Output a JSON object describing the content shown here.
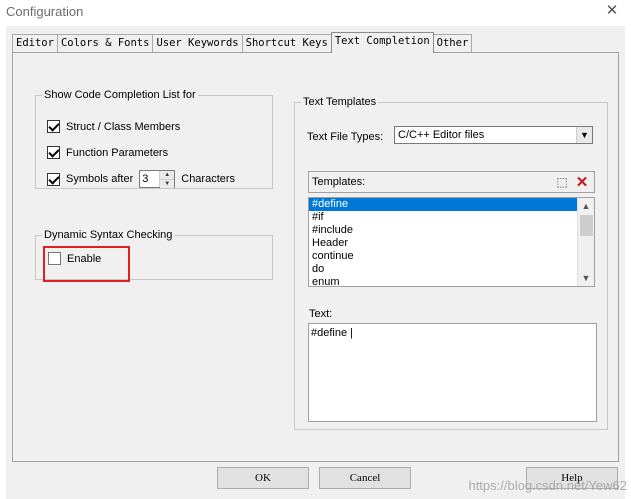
{
  "window": {
    "title": "Configuration",
    "close_glyph": "✕"
  },
  "tabs": [
    {
      "label": "Editor"
    },
    {
      "label": "Colors & Fonts"
    },
    {
      "label": "User Keywords"
    },
    {
      "label": "Shortcut Keys"
    },
    {
      "label": "Text Completion"
    },
    {
      "label": "Other"
    }
  ],
  "active_tab": "Text Completion",
  "code_completion": {
    "legend": "Show Code Completion List for",
    "struct_members": {
      "label": "Struct / Class Members",
      "checked": true
    },
    "function_params": {
      "label": "Function Parameters",
      "checked": true
    },
    "symbols_after": {
      "label": "Symbols after",
      "value": "3",
      "suffix": "Characters",
      "checked": true
    }
  },
  "syntax_checking": {
    "legend": "Dynamic Syntax Checking",
    "enable": {
      "label": "Enable",
      "checked": false
    },
    "highlight_color": "#e02020"
  },
  "text_templates": {
    "legend": "Text Templates",
    "file_types_label": "Text File Types:",
    "file_types_value": "C/C++ Editor files",
    "templates_label": "Templates:",
    "items": [
      "#define",
      "#if",
      "#include",
      "Header",
      "continue",
      "do",
      "enum"
    ],
    "selected_index": 0,
    "text_label": "Text:",
    "text_value": "#define |"
  },
  "buttons": {
    "ok": "OK",
    "cancel": "Cancel",
    "help": "Help"
  },
  "watermark": "https://blog.csdn.net/Yew62",
  "colors": {
    "selection": "#0078d7",
    "dialog_bg": "#f0f0f0"
  }
}
